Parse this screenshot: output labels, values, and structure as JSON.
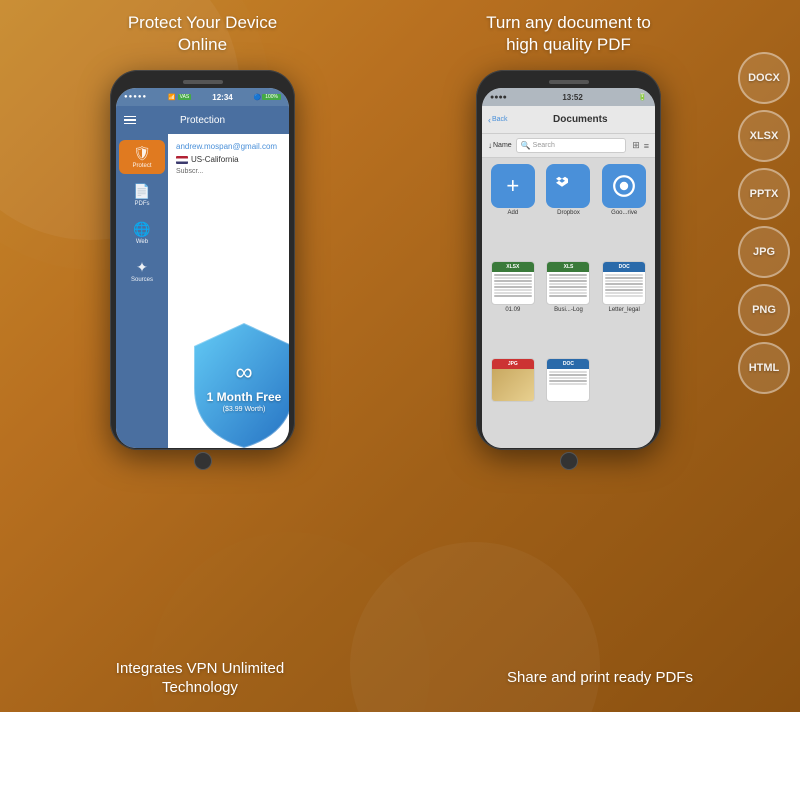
{
  "left_panel": {
    "title": "Protect Your Device\nOnline",
    "phone": {
      "status_bar": {
        "dots": "●●●●●",
        "wifi": "WiFi",
        "carrier": "VAS",
        "time": "12:34",
        "bluetooth": "B",
        "battery": "100%"
      },
      "nav_title": "Protection",
      "sidebar": {
        "items": [
          {
            "label": "Protect",
            "icon": "🛡",
            "active": true
          },
          {
            "label": "PDFs",
            "icon": "📄",
            "active": false
          },
          {
            "label": "Web",
            "icon": "🌐",
            "active": false
          },
          {
            "label": "Sources",
            "icon": "🔗",
            "active": false
          }
        ]
      },
      "content": {
        "email": "andrew.mospan@gmail.com",
        "location": "US-California",
        "sub_label": "Subscr...",
        "shield": {
          "offer": "1 Month Free",
          "worth": "($3.99 Worth)"
        }
      }
    },
    "bottom_label": "Integrates VPN Unlimited\nTechnology"
  },
  "right_panel": {
    "title": "Turn any document to\nhigh quality PDF",
    "phone": {
      "status_bar": {
        "dots": "●●●●",
        "wifi": "WiFi",
        "time": "13:52",
        "bluetooth": "B",
        "battery": "▌▌▌"
      },
      "nav": {
        "back": "Back",
        "title": "Documents"
      },
      "toolbar": {
        "sort_label": "Name",
        "search_placeholder": "Search",
        "grid_icon": "⊞",
        "list_icon": "≡"
      },
      "items": [
        {
          "type": "add",
          "label": "Add"
        },
        {
          "type": "dropbox",
          "label": "Dropbox"
        },
        {
          "type": "drive",
          "label": "Goo...rive"
        },
        {
          "type": "xlsx",
          "label": "01.09",
          "badge": "XLSX"
        },
        {
          "type": "xls",
          "label": "Busi...-Log",
          "badge": "XLS"
        },
        {
          "type": "doc",
          "label": "Letter_legal",
          "badge": "DOC"
        },
        {
          "type": "jpg",
          "label": "",
          "badge": "JPG"
        },
        {
          "type": "doc2",
          "label": "",
          "badge": "DOC"
        }
      ]
    },
    "format_badges": [
      "DOCX",
      "XLSX",
      "PPTX",
      "JPG",
      "PNG",
      "HTML"
    ],
    "bottom_label": "Share and print ready PDFs"
  }
}
